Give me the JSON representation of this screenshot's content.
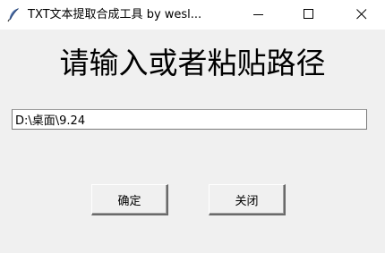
{
  "window": {
    "title": "TXT文本提取合成工具 by wesl...",
    "icon": "feather-icon"
  },
  "controls": {
    "minimize_icon": "minimize-icon",
    "maximize_icon": "maximize-icon",
    "close_icon": "close-icon"
  },
  "main": {
    "prompt": "请输入或者粘贴路径",
    "path_value": "D:\\桌面\\9.24",
    "confirm_label": "确定",
    "close_label": "关闭"
  }
}
